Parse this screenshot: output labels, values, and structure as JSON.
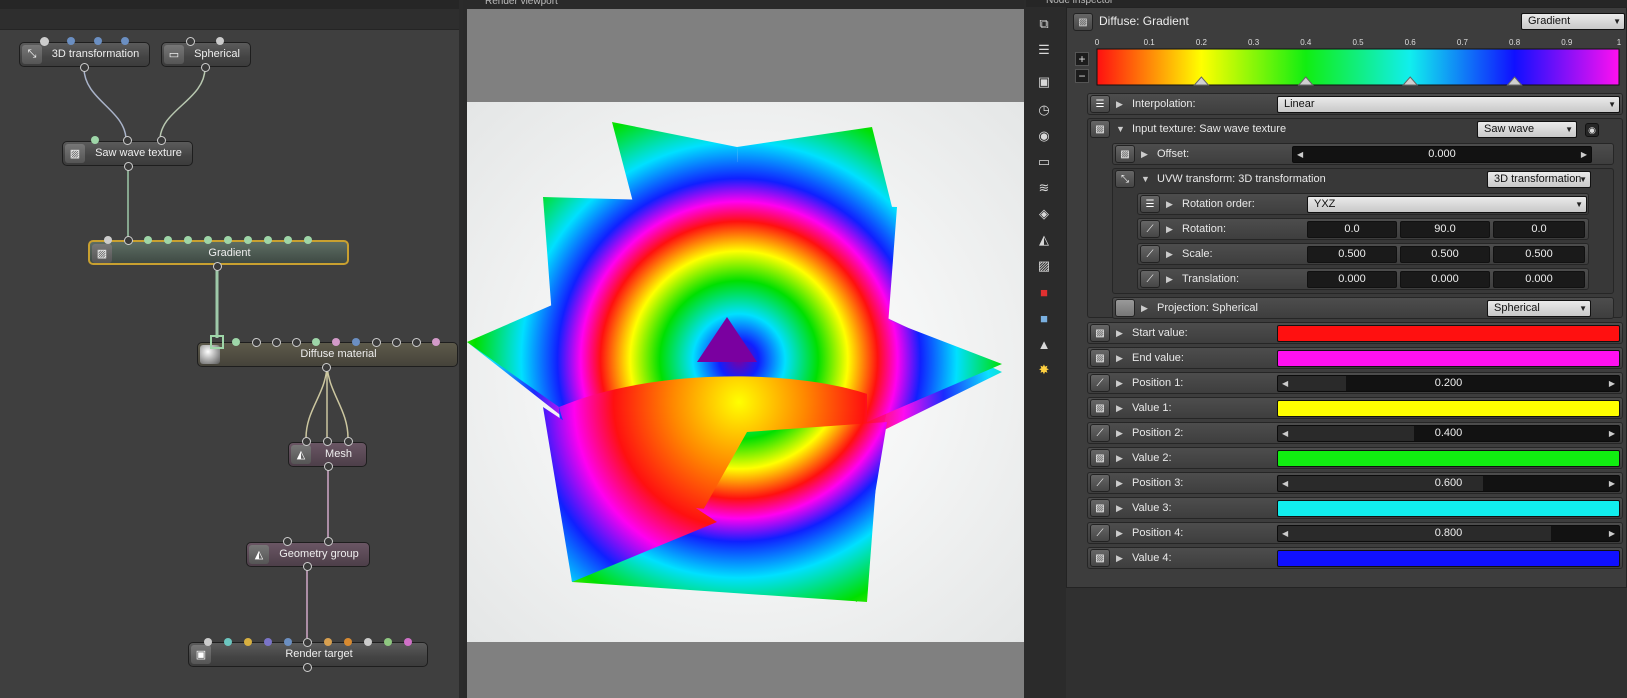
{
  "viewport": {
    "title": "Render viewport"
  },
  "inspector": {
    "title": "Node inspector",
    "header": {
      "label": "Diffuse: Gradient",
      "type": "Gradient"
    },
    "ramp": {
      "ticks": [
        "0",
        "0.1",
        "0.2",
        "0.3",
        "0.4",
        "0.5",
        "0.6",
        "0.7",
        "0.8",
        "0.9",
        "1"
      ],
      "stops": [
        0.2,
        0.4,
        0.6,
        0.8
      ]
    },
    "rows": {
      "interpolation": {
        "label": "Interpolation:",
        "value": "Linear"
      },
      "input_texture": {
        "label": "Input texture: Saw wave texture",
        "value": "Saw wave"
      },
      "offset": {
        "label": "Offset:",
        "value": "0.000"
      },
      "uvw": {
        "label": "UVW transform: 3D transformation",
        "value": "3D transformation"
      },
      "rotation_order": {
        "label": "Rotation order:",
        "value": "YXZ"
      },
      "rotation": {
        "label": "Rotation:",
        "x": "0.0",
        "y": "90.0",
        "z": "0.0"
      },
      "scale": {
        "label": "Scale:",
        "x": "0.500",
        "y": "0.500",
        "z": "0.500"
      },
      "translation": {
        "label": "Translation:",
        "x": "0.000",
        "y": "0.000",
        "z": "0.000"
      },
      "projection": {
        "label": "Projection: Spherical",
        "value": "Spherical"
      },
      "start_value": {
        "label": "Start value:",
        "color": "#ff1010"
      },
      "end_value": {
        "label": "End value:",
        "color": "#ff10f0"
      },
      "position1": {
        "label": "Position 1:",
        "value": "0.200",
        "fraction": 0.2
      },
      "value1": {
        "label": "Value 1:",
        "color": "#ffff00"
      },
      "position2": {
        "label": "Position 2:",
        "value": "0.400",
        "fraction": 0.4
      },
      "value2": {
        "label": "Value 2:",
        "color": "#11ee11"
      },
      "position3": {
        "label": "Position 3:",
        "value": "0.600",
        "fraction": 0.6
      },
      "value3": {
        "label": "Value 3:",
        "color": "#11eeee"
      },
      "position4": {
        "label": "Position 4:",
        "value": "0.800",
        "fraction": 0.8
      },
      "value4": {
        "label": "Value 4:",
        "color": "#1010ff"
      }
    }
  },
  "graph": {
    "nodes": {
      "transform3d": "3D transformation",
      "spherical": "Spherical",
      "sawwave": "Saw wave texture",
      "gradient": "Gradient",
      "diffuse": "Diffuse material",
      "mesh": "Mesh",
      "geometry": "Geometry group",
      "render": "Render target"
    }
  },
  "icons": {
    "plus": "+",
    "minus": "−"
  }
}
